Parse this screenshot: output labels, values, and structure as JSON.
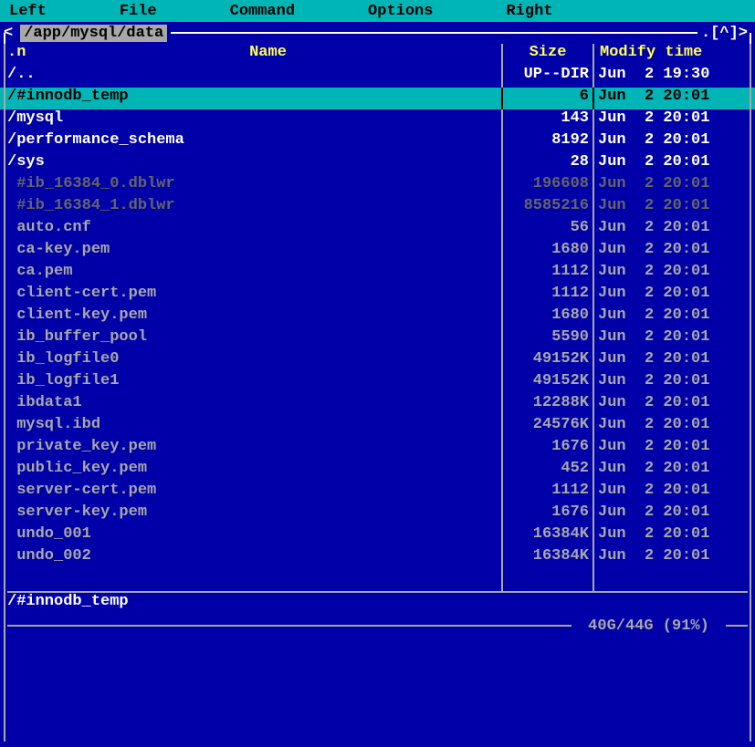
{
  "menubar": {
    "left": "Left",
    "file": "File",
    "command": "Command",
    "options": "Options",
    "right": "Right"
  },
  "panel": {
    "arrow": "<",
    "path": "/app/mysql/data",
    "up_indicator": ".[^]>",
    "headers": {
      "n": ".n",
      "name": "Name",
      "size": "Size",
      "mtime": "Modify time"
    },
    "rows": [
      {
        "name": "/..",
        "size": "UP--DIR",
        "mtime": "Jun  2 19:30",
        "cls": "dir"
      },
      {
        "name": "/#innodb_temp",
        "size": "6",
        "mtime": "Jun  2 20:01",
        "cls": "selected"
      },
      {
        "name": "/mysql",
        "size": "143",
        "mtime": "Jun  2 20:01",
        "cls": "dir"
      },
      {
        "name": "/performance_schema",
        "size": "8192",
        "mtime": "Jun  2 20:01",
        "cls": "dir"
      },
      {
        "name": "/sys",
        "size": "28",
        "mtime": "Jun  2 20:01",
        "cls": "dir"
      },
      {
        "name": " #ib_16384_0.dblwr",
        "size": "196608",
        "mtime": "Jun  2 20:01",
        "cls": "special"
      },
      {
        "name": " #ib_16384_1.dblwr",
        "size": "8585216",
        "mtime": "Jun  2 20:01",
        "cls": "special"
      },
      {
        "name": " auto.cnf",
        "size": "56",
        "mtime": "Jun  2 20:01",
        "cls": ""
      },
      {
        "name": " ca-key.pem",
        "size": "1680",
        "mtime": "Jun  2 20:01",
        "cls": ""
      },
      {
        "name": " ca.pem",
        "size": "1112",
        "mtime": "Jun  2 20:01",
        "cls": ""
      },
      {
        "name": " client-cert.pem",
        "size": "1112",
        "mtime": "Jun  2 20:01",
        "cls": ""
      },
      {
        "name": " client-key.pem",
        "size": "1680",
        "mtime": "Jun  2 20:01",
        "cls": ""
      },
      {
        "name": " ib_buffer_pool",
        "size": "5590",
        "mtime": "Jun  2 20:01",
        "cls": ""
      },
      {
        "name": " ib_logfile0",
        "size": "49152K",
        "mtime": "Jun  2 20:01",
        "cls": ""
      },
      {
        "name": " ib_logfile1",
        "size": "49152K",
        "mtime": "Jun  2 20:01",
        "cls": ""
      },
      {
        "name": " ibdata1",
        "size": "12288K",
        "mtime": "Jun  2 20:01",
        "cls": ""
      },
      {
        "name": " mysql.ibd",
        "size": "24576K",
        "mtime": "Jun  2 20:01",
        "cls": ""
      },
      {
        "name": " private_key.pem",
        "size": "1676",
        "mtime": "Jun  2 20:01",
        "cls": ""
      },
      {
        "name": " public_key.pem",
        "size": "452",
        "mtime": "Jun  2 20:01",
        "cls": ""
      },
      {
        "name": " server-cert.pem",
        "size": "1112",
        "mtime": "Jun  2 20:01",
        "cls": ""
      },
      {
        "name": " server-key.pem",
        "size": "1676",
        "mtime": "Jun  2 20:01",
        "cls": ""
      },
      {
        "name": " undo_001",
        "size": "16384K",
        "mtime": "Jun  2 20:01",
        "cls": ""
      },
      {
        "name": " undo_002",
        "size": "16384K",
        "mtime": "Jun  2 20:01",
        "cls": ""
      }
    ],
    "status": "/#innodb_temp",
    "disk": "40G/44G (91%)"
  }
}
